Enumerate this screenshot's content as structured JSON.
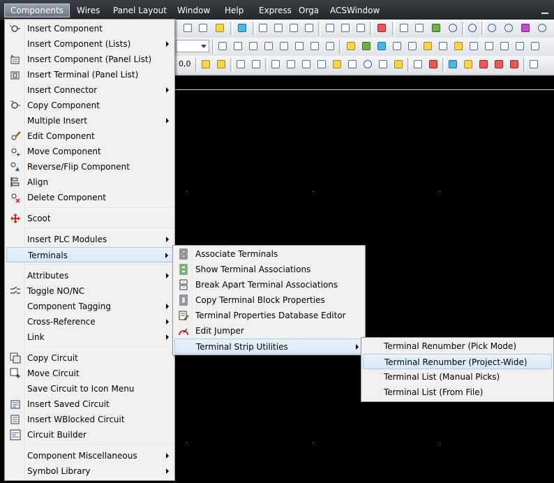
{
  "menubar": {
    "items": [
      "Components",
      "Wires",
      "Panel Layout",
      "Window",
      "Help",
      "Express",
      "Orga",
      "ACSWindow"
    ],
    "active": "Components"
  },
  "toolbar": {
    "zoom_text": "0,0"
  },
  "components_menu": {
    "items": [
      {
        "label": "Insert Component",
        "icon": "insert-component-icon",
        "submenu": false
      },
      {
        "label": "Insert Component (Lists)",
        "icon": "",
        "submenu": true
      },
      {
        "label": "Insert Component (Panel List)",
        "icon": "panel-list-icon",
        "submenu": false
      },
      {
        "label": "Insert Terminal (Panel List)",
        "icon": "terminal-panel-icon",
        "submenu": false
      },
      {
        "label": "Insert Connector",
        "icon": "",
        "submenu": true
      },
      {
        "label": "Copy Component",
        "icon": "copy-component-icon",
        "submenu": false
      },
      {
        "label": "Multiple Insert",
        "icon": "",
        "submenu": true
      },
      {
        "label": "Edit Component",
        "icon": "edit-component-icon",
        "submenu": false
      },
      {
        "label": "Move Component",
        "icon": "move-component-icon",
        "submenu": false
      },
      {
        "label": "Reverse/Flip Component",
        "icon": "flip-component-icon",
        "submenu": false
      },
      {
        "label": "Align",
        "icon": "align-icon",
        "submenu": false
      },
      {
        "label": "Delete Component",
        "icon": "delete-component-icon",
        "submenu": false
      },
      {
        "label": "Scoot",
        "icon": "scoot-icon",
        "submenu": false
      },
      {
        "label": "Insert PLC Modules",
        "icon": "",
        "submenu": true
      },
      {
        "label": "Terminals",
        "icon": "",
        "submenu": true
      },
      {
        "label": "Attributes",
        "icon": "",
        "submenu": true
      },
      {
        "label": "Toggle NO/NC",
        "icon": "toggle-nonc-icon",
        "submenu": false
      },
      {
        "label": "Component Tagging",
        "icon": "",
        "submenu": true
      },
      {
        "label": "Cross-Reference",
        "icon": "",
        "submenu": true
      },
      {
        "label": "Link",
        "icon": "",
        "submenu": true
      },
      {
        "label": "Copy Circuit",
        "icon": "copy-circuit-icon",
        "submenu": false
      },
      {
        "label": "Move Circuit",
        "icon": "move-circuit-icon",
        "submenu": false
      },
      {
        "label": "Save Circuit to Icon Menu",
        "icon": "",
        "submenu": false
      },
      {
        "label": "Insert Saved Circuit",
        "icon": "insert-saved-circuit-icon",
        "submenu": false
      },
      {
        "label": "Insert WBlocked Circuit",
        "icon": "insert-wblocked-circuit-icon",
        "submenu": false
      },
      {
        "label": "Circuit Builder",
        "icon": "circuit-builder-icon",
        "submenu": false
      },
      {
        "label": "Component Miscellaneous",
        "icon": "",
        "submenu": true
      },
      {
        "label": "Symbol Library",
        "icon": "",
        "submenu": true
      }
    ]
  },
  "terminals_menu": {
    "items": [
      {
        "label": "Associate Terminals",
        "icon": "associate-terminals-icon",
        "submenu": false
      },
      {
        "label": "Show Terminal Associations",
        "icon": "show-associations-icon",
        "submenu": false
      },
      {
        "label": "Break Apart Terminal Associations",
        "icon": "break-apart-icon",
        "submenu": false
      },
      {
        "label": "Copy Terminal Block Properties",
        "icon": "copy-block-properties-icon",
        "submenu": false
      },
      {
        "label": "Terminal Properties Database Editor",
        "icon": "database-editor-icon",
        "submenu": false
      },
      {
        "label": "Edit Jumper",
        "icon": "edit-jumper-icon",
        "submenu": false
      },
      {
        "label": "Terminal Strip Utilities",
        "icon": "",
        "submenu": true
      }
    ]
  },
  "strip_utilities_menu": {
    "items": [
      {
        "label": "Terminal Renumber (Pick Mode)"
      },
      {
        "label": "Terminal Renumber (Project-Wide)"
      },
      {
        "label": "Terminal List (Manual Picks)"
      },
      {
        "label": "Terminal List (From File)"
      }
    ],
    "highlighted": "Terminal Renumber (Project-Wide)"
  }
}
